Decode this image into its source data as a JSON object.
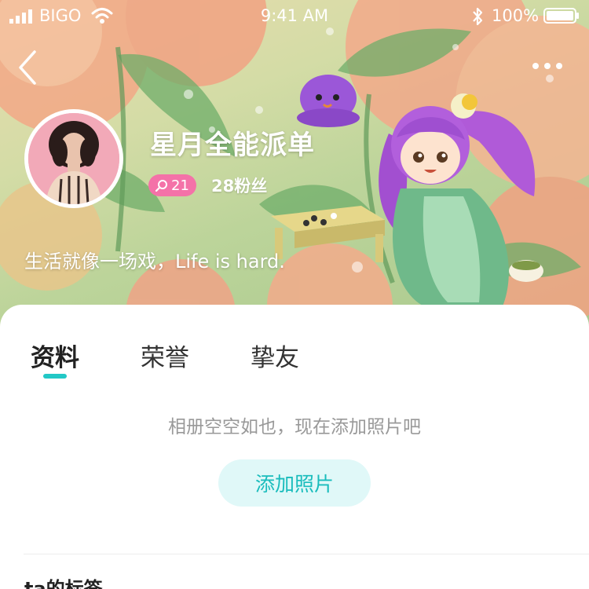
{
  "status_bar": {
    "carrier": "BIGO",
    "time": "9:41 AM",
    "battery": "100%"
  },
  "nav": {
    "back_icon": "chevron-left-icon",
    "more_icon": "ellipsis-icon"
  },
  "profile": {
    "name": "星月全能派单",
    "level": "21",
    "fans_count": "28",
    "fans_label": "粉丝",
    "signature": "生活就像一场戏，Life is hard."
  },
  "tabs": [
    {
      "label": "资料",
      "active": true
    },
    {
      "label": "荣誉",
      "active": false
    },
    {
      "label": "挚友",
      "active": false
    }
  ],
  "album": {
    "empty_text": "相册空空如也，现在添加照片吧",
    "add_button": "添加照片"
  },
  "tags_section": {
    "title": "ta的标签"
  },
  "colors": {
    "accent": "#22c8c6",
    "level_badge": "#f472a8",
    "button_bg": "#e0f8f8"
  }
}
